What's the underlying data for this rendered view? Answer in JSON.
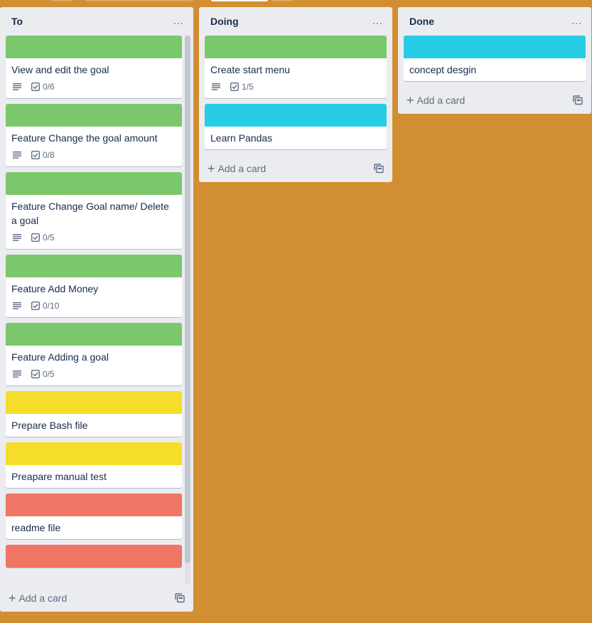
{
  "colors": {
    "board_bg": "#d18f32",
    "list_bg": "#ebecf0",
    "green": "#7bc86c",
    "sky": "#29cce5",
    "yellow": "#f5dd29",
    "red": "#ef7564"
  },
  "lists": [
    {
      "title": "To",
      "menu_icon": "…",
      "add_card_label": "Add a card",
      "cards": [
        {
          "title": "View and edit the goal",
          "cover": "green",
          "description_icon": "description-icon",
          "checklist": "0/6"
        },
        {
          "title": "Feature Change the goal amount",
          "cover": "green",
          "description_icon": "description-icon",
          "checklist": "0/8"
        },
        {
          "title": "Feature Change Goal name/ Delete a goal",
          "cover": "green",
          "description_icon": "description-icon",
          "checklist": "0/5"
        },
        {
          "title": "Feature Add Money",
          "cover": "green",
          "description_icon": "description-icon",
          "checklist": "0/10"
        },
        {
          "title": "Feature Adding a goal",
          "cover": "green",
          "description_icon": "description-icon",
          "checklist": "0/5"
        },
        {
          "title": "Prepare Bash file",
          "cover": "yellow"
        },
        {
          "title": "Preapare manual test",
          "cover": "yellow"
        },
        {
          "title": "readme file",
          "cover": "red"
        },
        {
          "title": "",
          "cover": "red"
        }
      ]
    },
    {
      "title": "Doing",
      "menu_icon": "…",
      "add_card_label": "Add a card",
      "cards": [
        {
          "title": "Create start menu",
          "cover": "green",
          "description_icon": "description-icon",
          "checklist": "1/5"
        },
        {
          "title": "Learn Pandas",
          "cover": "sky"
        }
      ]
    },
    {
      "title": "Done",
      "menu_icon": "…",
      "add_card_label": "Add a card",
      "cards": [
        {
          "title": "concept desgin",
          "cover": "sky"
        }
      ]
    }
  ]
}
